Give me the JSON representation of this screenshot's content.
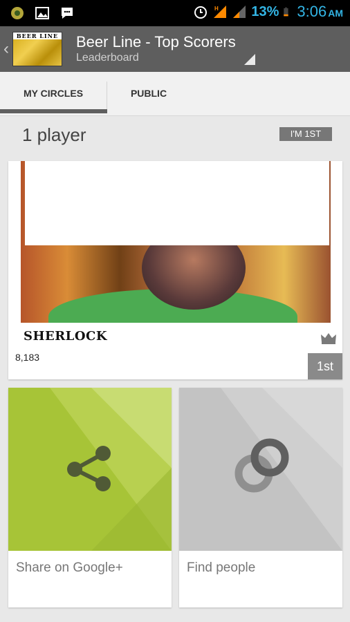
{
  "status_bar": {
    "battery_percent": "13%",
    "time": "3:06",
    "ampm": "AM",
    "icons": [
      "app-icon",
      "gallery-icon",
      "chat-icon",
      "alarm-icon",
      "signal-h-icon",
      "signal-icon",
      "battery-icon"
    ]
  },
  "action_bar": {
    "logo_text": "BEER LINE",
    "title": "Beer Line - Top Scorers",
    "subtitle": "Leaderboard"
  },
  "tabs": [
    {
      "label": "MY CIRCLES",
      "selected": true
    },
    {
      "label": "PUBLIC",
      "selected": false
    }
  ],
  "leaderboard": {
    "player_count": "1 player",
    "jump_label": "I'M 1ST",
    "players": [
      {
        "name": "SHERLOCK",
        "score": "8,183",
        "rank": "1st"
      }
    ]
  },
  "tiles": [
    {
      "label": "Share on Google+",
      "icon": "share-icon",
      "color": "#a7c437"
    },
    {
      "label": "Find people",
      "icon": "circles-icon",
      "color": "#c3c3c3"
    }
  ],
  "colors": {
    "accent_blue": "#33b5e5",
    "action_bar": "#5e5e5e",
    "share_green": "#a7c437"
  }
}
